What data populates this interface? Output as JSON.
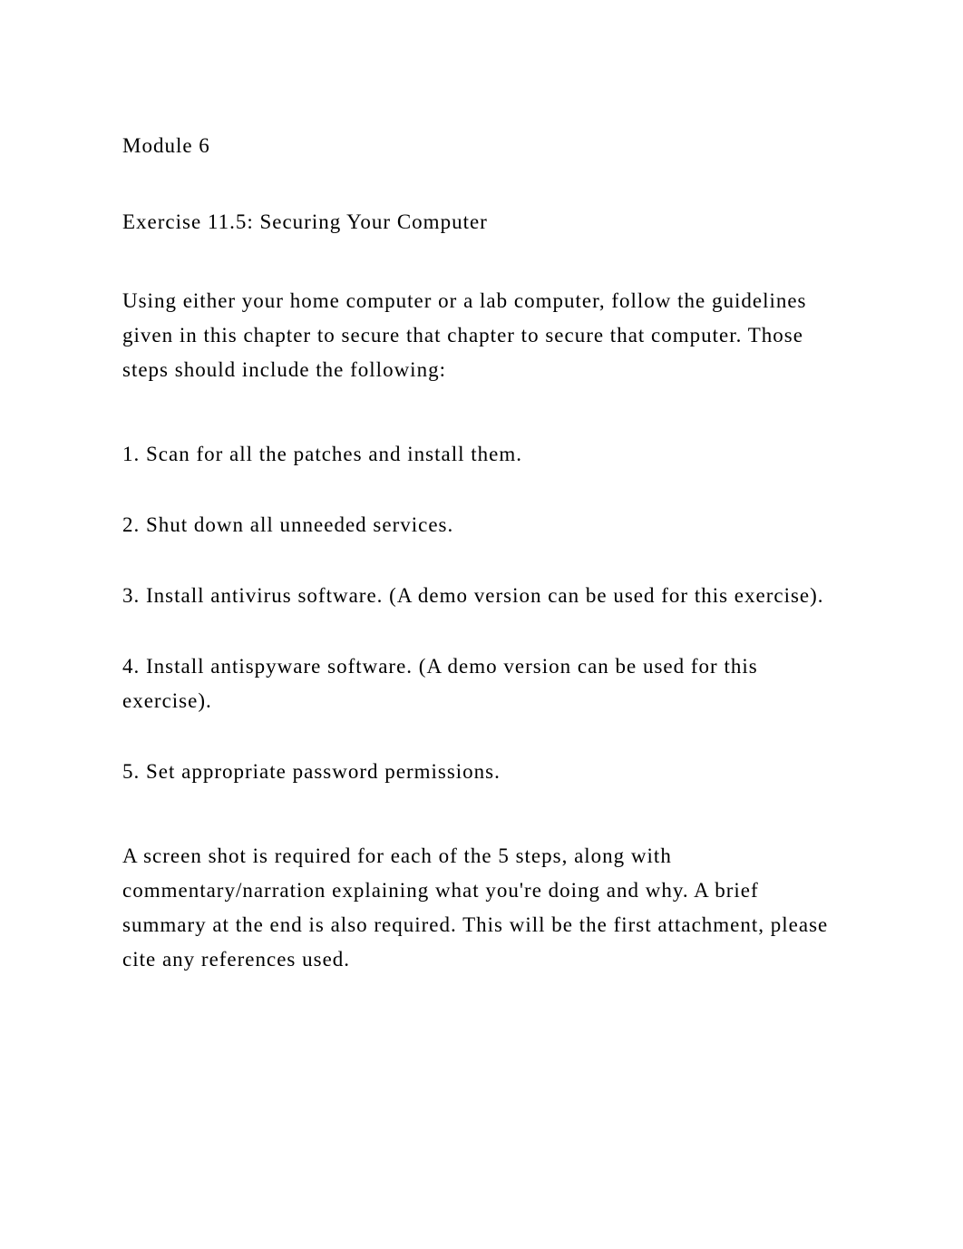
{
  "module": {
    "heading": "Module 6"
  },
  "exercise": {
    "title": "Exercise 11.5: Securing Your Computer"
  },
  "intro": {
    "text": "Using either your home computer or a lab computer, follow the guidelines given in this chapter to secure that chapter to secure that computer. Those steps should include the following:"
  },
  "steps": [
    {
      "text": "1. Scan for all the patches and install them."
    },
    {
      "text": "2. Shut down all unneeded services."
    },
    {
      "text": "3. Install antivirus software. (A demo version can be used for this exercise)."
    },
    {
      "text": "4. Install antispyware software. (A demo version can be used for this exercise)."
    },
    {
      "text": "5. Set appropriate password permissions."
    }
  ],
  "closing": {
    "text": "A screen shot is required for each of the 5 steps, along with commentary/narration explaining what you're doing and why.  A brief summary at the end is also required. This will be the first attachment, please cite any references used."
  }
}
